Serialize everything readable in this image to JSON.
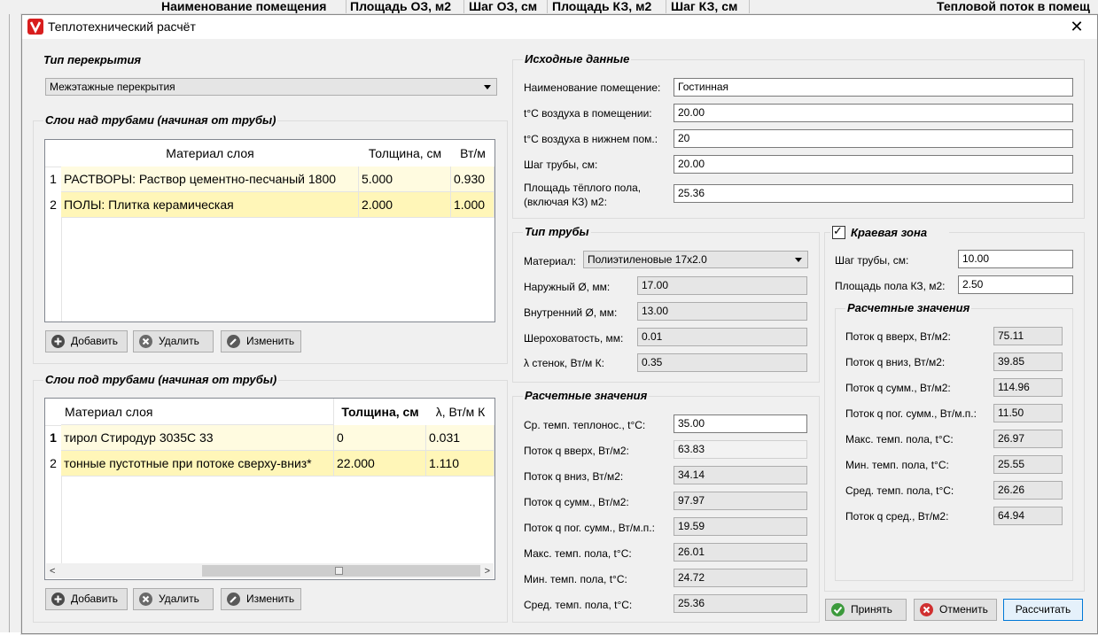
{
  "background": {
    "columns": [
      "Наименование помещения",
      "Площадь ОЗ, м2",
      "Шаг ОЗ, см",
      "Площадь КЗ, м2",
      "Шаг КЗ, см",
      "Тепловой поток в помещ"
    ]
  },
  "window": {
    "title": "Теплотехнический расчёт",
    "close_label": "✕",
    "accent_color": "#d81e1e"
  },
  "floor_type": {
    "title": "Тип перекрытия",
    "selected": "Межэтажные перекрытия"
  },
  "layers_above": {
    "title": "Слои над трубами (начиная от трубы)",
    "columns": [
      "Материал слоя",
      "Толщина, см",
      "Вт/м"
    ],
    "rows": [
      {
        "num": "1",
        "material": "РАСТВОРЫ: Раствор цементно-песчаный 1800",
        "thickness": "5.000",
        "lambda": "0.930"
      },
      {
        "num": "2",
        "material": "ПОЛЫ: Плитка керамическая",
        "thickness": "2.000",
        "lambda": "1.000"
      }
    ],
    "buttons": {
      "add": "Добавить",
      "delete": "Удалить",
      "edit": "Изменить"
    }
  },
  "layers_below": {
    "title": "Слои под трубами (начиная от трубы)",
    "columns": [
      "Материал слоя",
      "Толщина, см",
      "λ, Вт/м К"
    ],
    "rows": [
      {
        "num": "1",
        "material": "тирол Стиродур 3035С 33",
        "thickness": "0",
        "lambda": "0.031"
      },
      {
        "num": "2",
        "material": "тонные пустотные при потоке сверху-вниз*",
        "thickness": "22.000",
        "lambda": "1.110"
      }
    ],
    "buttons": {
      "add": "Добавить",
      "delete": "Удалить",
      "edit": "Изменить"
    }
  },
  "source_data": {
    "title": "Исходные данные",
    "room_name_label": "Наименование помещение:",
    "room_name": "Гостинная",
    "air_temp_label": "t°C воздуха в помещении:",
    "air_temp": "20.00",
    "lower_air_temp_label": "t°C воздуха в нижнем пом.:",
    "lower_air_temp": "20",
    "pipe_step_label": "Шаг трубы, см:",
    "pipe_step": "20.00",
    "area_label_1": "Площадь тёплого пола,",
    "area_label_2": "(включая КЗ) м2:",
    "area": "25.36"
  },
  "pipe_type": {
    "title": "Тип трубы",
    "material_label": "Материал:",
    "material": "Полиэтиленовые 17x2.0",
    "outer_d_label": "Наружный Ø, мм:",
    "outer_d": "17.00",
    "inner_d_label": "Внутренний Ø, мм:",
    "inner_d": "13.00",
    "roughness_label": "Шероховатость, мм:",
    "roughness": "0.01",
    "wall_lambda_label": "λ стенок, Вт/м К:",
    "wall_lambda": "0.35"
  },
  "calc_main": {
    "title": "Расчетные значения",
    "rows": [
      {
        "label": "Ср. темп. теплонос., t°C:",
        "value": "35.00"
      },
      {
        "label": "Поток q вверх, Вт/м2:",
        "value": "63.83"
      },
      {
        "label": "Поток q вниз, Вт/м2:",
        "value": "34.14"
      },
      {
        "label": "Поток q сумм., Вт/м2:",
        "value": "97.97"
      },
      {
        "label": "Поток q пог. сумм., Вт/м.п.:",
        "value": "19.59"
      },
      {
        "label": "Макс. темп. пола, t°C:",
        "value": "26.01"
      },
      {
        "label": "Мин. темп. пола, t°C:",
        "value": "24.72"
      },
      {
        "label": "Сред. темп. пола, t°C:",
        "value": "25.36"
      }
    ]
  },
  "edge_zone": {
    "title": "Краевая зона",
    "checked": true,
    "check_mark": "✓",
    "pipe_step_label": "Шаг трубы, см:",
    "pipe_step": "10.00",
    "area_label": "Площадь пола КЗ, м2:",
    "area": "2.50",
    "calc_title": "Расчетные значения",
    "rows": [
      {
        "label": "Поток q вверх, Вт/м2:",
        "value": "75.11"
      },
      {
        "label": "Поток q вниз, Вт/м2:",
        "value": "39.85"
      },
      {
        "label": "Поток q сумм., Вт/м2:",
        "value": "114.96"
      },
      {
        "label": "Поток q пог. сумм., Вт/м.п.:",
        "value": "11.50"
      },
      {
        "label": "Макс. темп. пола, t°C:",
        "value": "26.97"
      },
      {
        "label": "Мин. темп. пола, t°C:",
        "value": "25.55"
      },
      {
        "label": "Сред. темп. пола, t°C:",
        "value": "26.26"
      },
      {
        "label": "Поток q сред., Вт/м2:",
        "value": "64.94"
      }
    ]
  },
  "footer": {
    "accept": "Принять",
    "cancel": "Отменить",
    "calculate": "Рассчитать"
  }
}
